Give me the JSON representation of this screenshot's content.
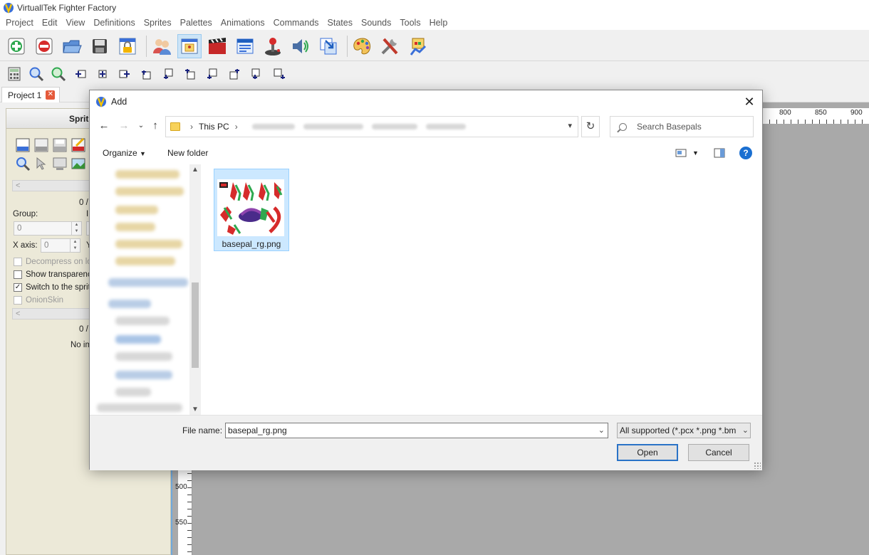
{
  "app": {
    "title": "VirtuallTek Fighter Factory",
    "menus": [
      "Project",
      "Edit",
      "View",
      "Definitions",
      "Sprites",
      "Palettes",
      "Animations",
      "Commands",
      "States",
      "Sounds",
      "Tools",
      "Help"
    ],
    "toolbar_icons": [
      "new-project-icon",
      "close-project-icon",
      "open-project-icon",
      "save-icon",
      "lock-icon",
      "characters-icon",
      "sprites-icon",
      "animations-icon",
      "definitions-icon",
      "commands-joystick-icon",
      "sounds-icon",
      "export-icon",
      "palette-icon",
      "tools-icon",
      "settings-icon"
    ],
    "active_toolbar_icon": "sprites-icon",
    "tab": {
      "label": "Project 1"
    }
  },
  "sprite_panel": {
    "title": "Sprit",
    "counter_top": "0 /",
    "group_label": "Group:",
    "group_value": "0",
    "xaxis_label": "X axis:",
    "xaxis_value": "0",
    "checkboxes": [
      {
        "label": "Decompress on loa",
        "checked": false,
        "disabled": true
      },
      {
        "label": "Show transparency",
        "checked": false,
        "disabled": false
      },
      {
        "label": "Switch to the sprite",
        "checked": true,
        "disabled": false
      },
      {
        "label": "OnionSkin",
        "checked": false,
        "disabled": true
      }
    ],
    "counter_bottom": "0 /",
    "no_image_text": "No im"
  },
  "rulers": {
    "horizontal": [
      "800",
      "850",
      "900"
    ],
    "vertical": [
      "500",
      "550"
    ]
  },
  "dialog": {
    "title": "Add",
    "breadcrumb_root": "This PC",
    "search_placeholder": "Search Basepals",
    "organize_label": "Organize",
    "new_folder_label": "New folder",
    "files": [
      {
        "name": "basepal_rg.png",
        "selected": true
      }
    ],
    "file_name_label": "File name:",
    "file_name_value": "basepal_rg.png",
    "filter_value": "All supported (*.pcx *.png *.bm",
    "open_label": "Open",
    "cancel_label": "Cancel"
  },
  "colors": {
    "accent": "#2a73c7",
    "selection": "#cce8ff",
    "canvas": "#a9a9a9",
    "panel": "#ece9d8"
  }
}
